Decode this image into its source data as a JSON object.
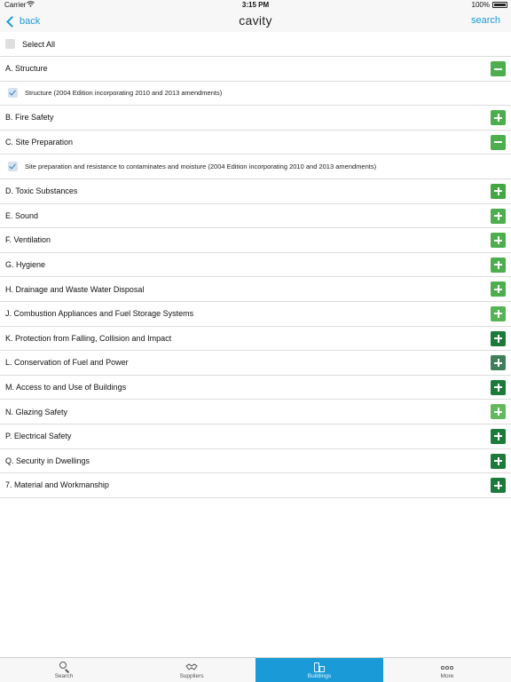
{
  "status_bar": {
    "carrier": "Carrier",
    "time": "3:15 PM",
    "battery": "100%"
  },
  "nav": {
    "back_label": "back",
    "title": "cavity",
    "search_label": "search"
  },
  "select_all": {
    "label": "Select All",
    "checked": false
  },
  "sections": [
    {
      "label": "A. Structure",
      "expanded": true,
      "color": "#4cae4c",
      "children": [
        {
          "label": "Structure (2004 Edition incorporating 2010 and 2013 amendments)",
          "checked": true
        }
      ]
    },
    {
      "label": "B. Fire Safety",
      "expanded": false,
      "color": "#4cae4c",
      "children": []
    },
    {
      "label": "C. Site Preparation",
      "expanded": true,
      "color": "#4cae4c",
      "children": [
        {
          "label": "Site preparation and resistance to contaminates and moisture (2004 Edition incorporating 2010 and 2013 amendments)",
          "checked": true
        }
      ]
    },
    {
      "label": "D. Toxic Substances",
      "expanded": false,
      "color": "#43a843",
      "children": []
    },
    {
      "label": "E. Sound",
      "expanded": false,
      "color": "#4cae4c",
      "children": []
    },
    {
      "label": "F. Ventilation",
      "expanded": false,
      "color": "#4cae4c",
      "children": []
    },
    {
      "label": "G. Hygiene",
      "expanded": false,
      "color": "#4cae4c",
      "children": []
    },
    {
      "label": "H. Drainage and Waste Water Disposal",
      "expanded": false,
      "color": "#4cae4c",
      "children": []
    },
    {
      "label": "J. Combustion Appliances and Fuel Storage Systems",
      "expanded": false,
      "color": "#55b455",
      "children": []
    },
    {
      "label": "K. Protection from Falling, Collision and Impact",
      "expanded": false,
      "color": "#1c7a3a",
      "children": []
    },
    {
      "label": "L. Conservation of Fuel and Power",
      "expanded": false,
      "color": "#3f7f5a",
      "children": []
    },
    {
      "label": "M. Access to and Use of Buildings",
      "expanded": false,
      "color": "#1c7a3a",
      "children": []
    },
    {
      "label": "N. Glazing Safety",
      "expanded": false,
      "color": "#62b95c",
      "children": []
    },
    {
      "label": "P. Electrical Safety",
      "expanded": false,
      "color": "#1c7a3a",
      "children": []
    },
    {
      "label": "Q. Security in Dwellings",
      "expanded": false,
      "color": "#1c7a3a",
      "children": []
    },
    {
      "label": "7. Material and Workmanship",
      "expanded": false,
      "color": "#1c7a3a",
      "children": []
    }
  ],
  "tabs": [
    {
      "label": "Search",
      "icon": "search-icon",
      "active": false
    },
    {
      "label": "Suppliers",
      "icon": "handshake-icon",
      "active": false
    },
    {
      "label": "Buildings",
      "icon": "buildings-icon",
      "active": true
    },
    {
      "label": "More",
      "icon": "more-icon",
      "active": false
    }
  ]
}
